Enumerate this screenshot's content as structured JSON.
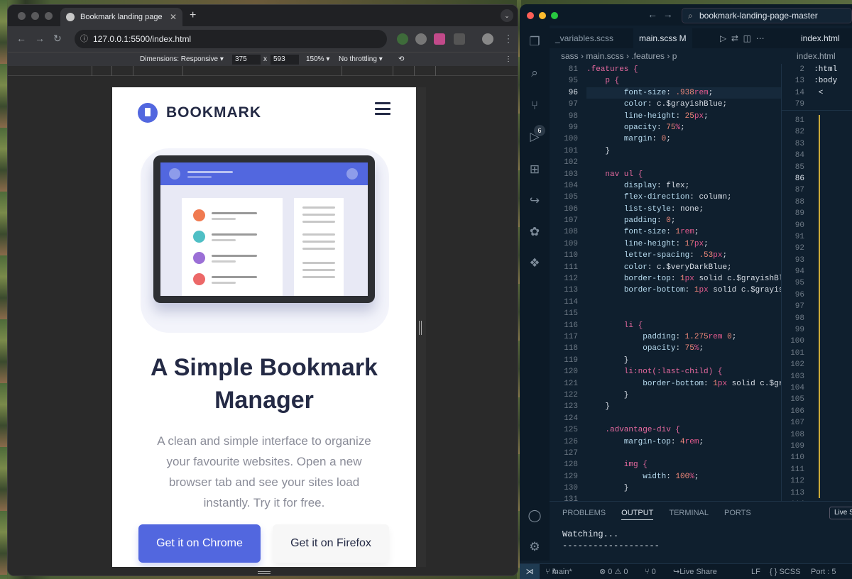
{
  "browser": {
    "tab_title": "Bookmark landing page",
    "url": "127.0.0.1:5500/index.html",
    "devtools": {
      "dimensions_label": "Dimensions: Responsive",
      "width": "375",
      "times": "x",
      "height": "593",
      "zoom": "150%",
      "throttling": "No throttling"
    }
  },
  "site": {
    "logo_text": "BOOKMARK",
    "hero_title": "A Simple Bookmark Manager",
    "hero_subtitle": "A clean and simple interface to organize your favourite websites. Open a new browser tab and see your sites load instantly. Try it for free.",
    "cta_chrome": "Get it on Chrome",
    "cta_firefox": "Get it on Firefox",
    "colors": {
      "primary": "#5267df",
      "dark": "#242a45",
      "grey": "#8a8c98"
    }
  },
  "vscode": {
    "title": "bookmark-landing-page-master",
    "source_control_badge": "6",
    "tabs": [
      {
        "label": "_variables.scss"
      },
      {
        "label": "main.scss  M"
      },
      {
        "label": "index.html"
      }
    ],
    "breadcrumbs": "sass  ›  main.scss  ›  .features  ›  p",
    "split_breadcrumb": "index.html",
    "line_numbers": [
      "81",
      "95",
      "96",
      "97",
      "98",
      "99",
      "100",
      "101",
      "102",
      "103",
      "104",
      "105",
      "106",
      "107",
      "108",
      "109",
      "110",
      "111",
      "112",
      "113",
      "114",
      "115",
      "116",
      "117",
      "118",
      "119",
      "120",
      "121",
      "122",
      "123",
      "124",
      "125",
      "126",
      "127",
      "128",
      "129",
      "130",
      "131"
    ],
    "code_lines": [
      ".features {",
      "    p {",
      "        font-size: .938rem;",
      "        color: c.$grayishBlue;",
      "        line-height: 25px;",
      "        opacity: 75%;",
      "        margin: 0;",
      "    }",
      "",
      "    nav ul {",
      "        display: flex;",
      "        flex-direction: column;",
      "        list-style: none;",
      "        padding: 0;",
      "        font-size: 1rem;",
      "        line-height: 17px;",
      "        letter-spacing: .53px;",
      "        color: c.$veryDarkBlue;",
      "        border-top: 1px solid c.$grayishBlu",
      "        border-bottom: 1px solid c.$grayisl",
      "",
      "",
      "        li {",
      "            padding: 1.275rem 0;",
      "            opacity: 75%;",
      "        }",
      "        li:not(:last-child) {",
      "            border-bottom: 1px solid c.$gra",
      "        }",
      "    }",
      "",
      "    .advantage-div {",
      "        margin-top: 4rem;",
      "",
      "        img {",
      "            width: 100%;",
      "        }",
      ""
    ],
    "split_sticky": [
      {
        "num": "2",
        "text": ":html"
      },
      {
        "num": "13",
        "text": ":body"
      },
      {
        "num": "14",
        "text": "  <"
      },
      {
        "num": "79",
        "text": ""
      }
    ],
    "split_line_numbers": [
      "81",
      "82",
      "83",
      "84",
      "85",
      "86",
      "87",
      "88",
      "89",
      "90",
      "91",
      "92",
      "93",
      "94",
      "95",
      "96",
      "97",
      "98",
      "99",
      "100",
      "101",
      "102",
      "103",
      "104",
      "105",
      "106",
      "107",
      "108",
      "109",
      "110",
      "111",
      "112",
      "113",
      "114"
    ],
    "panel_tabs": [
      "PROBLEMS",
      "OUTPUT",
      "TERMINAL",
      "PORTS"
    ],
    "panel_button": "Live S",
    "panel_output": "Watching...\n-------------------",
    "status": {
      "branch": "main*",
      "problems": "⊗ 0 ⚠ 0",
      "ports_count": "⑂ 0",
      "live_share": "Live Share",
      "eol": "LF",
      "language": "{ }  SCSS",
      "port": "Port : 5"
    }
  }
}
